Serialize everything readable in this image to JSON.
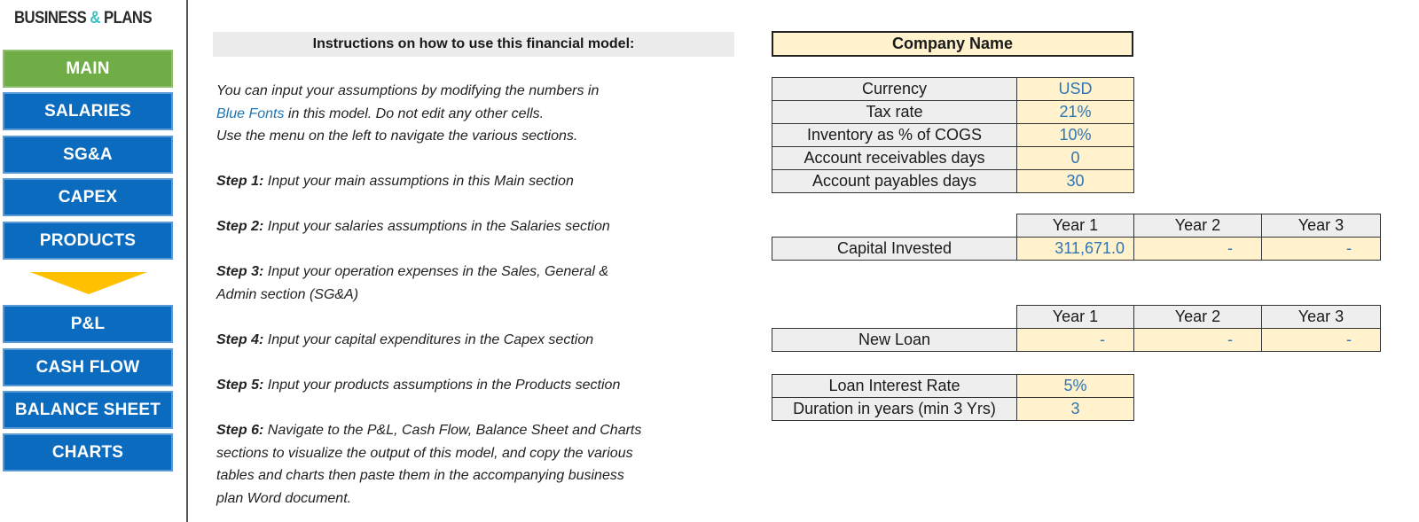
{
  "logo": {
    "part1": "BUSINESS ",
    "amp": "&",
    "part2": " PLANS"
  },
  "nav": [
    {
      "label": "MAIN",
      "active": true
    },
    {
      "label": "SALARIES"
    },
    {
      "label": "SG&A"
    },
    {
      "label": "CAPEX"
    },
    {
      "label": "PRODUCTS"
    },
    {
      "label": "P&L"
    },
    {
      "label": "CASH FLOW"
    },
    {
      "label": "BALANCE SHEET"
    },
    {
      "label": "CHARTS"
    }
  ],
  "instructions": {
    "header": "Instructions on how to use this financial model:",
    "intro_line1": "You can input your assumptions by modifying the numbers in",
    "intro_blue": "Blue Fonts",
    "intro_line2_rest": " in this model. Do not edit any other cells.",
    "intro_line3": "Use the menu on the left to navigate the various sections.",
    "steps": [
      {
        "label": "Step 1:",
        "text": " Input your main assumptions in this Main section"
      },
      {
        "label": "Step 2:",
        "text": " Input your salaries assumptions in the Salaries section"
      },
      {
        "label": "Step 3:",
        "text": " Input your operation expenses in the Sales, General &",
        "text2": "Admin section (SG&A)"
      },
      {
        "label": "Step 4:",
        "text": " Input your capital expenditures in the Capex section"
      },
      {
        "label": "Step 5:",
        "text": " Input your products assumptions in the Products section"
      },
      {
        "label": "Step 6:",
        "text": " Navigate to the P&L, Cash Flow, Balance Sheet and Charts",
        "text2": "sections to visualize the output of this model, and copy the various",
        "text3": "tables and charts then paste them in the accompanying business",
        "text4": "plan Word document."
      }
    ]
  },
  "company_name": "Company Name",
  "assumptions": [
    {
      "label": "Currency",
      "value": "USD"
    },
    {
      "label": "Tax rate",
      "value": "21%"
    },
    {
      "label": "Inventory as % of COGS",
      "value": "10%"
    },
    {
      "label": "Account receivables days",
      "value": "0"
    },
    {
      "label": "Account payables days",
      "value": "30"
    }
  ],
  "capital": {
    "years": [
      "Year 1",
      "Year 2",
      "Year 3"
    ],
    "label": "Capital Invested",
    "values": [
      "311,671.0",
      "-",
      "-"
    ]
  },
  "loan": {
    "years": [
      "Year 1",
      "Year 2",
      "Year 3"
    ],
    "label": "New Loan",
    "values": [
      "-",
      "-",
      "-"
    ]
  },
  "loan_terms": [
    {
      "label": "Loan Interest Rate",
      "value": "5%"
    },
    {
      "label": "Duration in years (min 3 Yrs)",
      "value": "3"
    }
  ]
}
